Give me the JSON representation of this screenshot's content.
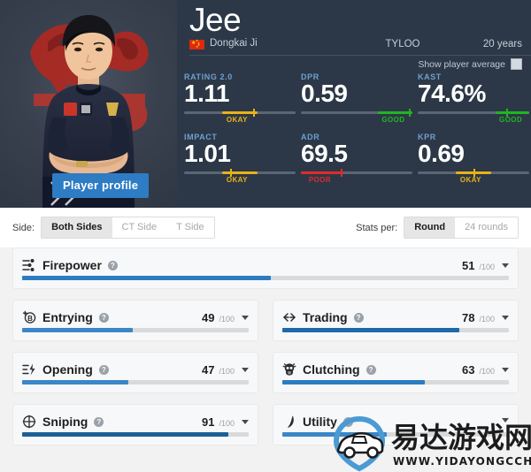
{
  "player": {
    "name": "Jee",
    "real_name": "Dongkai Ji",
    "country_icon": "china-flag-icon",
    "team": "TYLOO",
    "age": "20 years",
    "profile_button": "Player profile",
    "show_average_label": "Show player average"
  },
  "stats": [
    {
      "label": "RATING 2.0",
      "value": "1.11",
      "quality": "OKAY",
      "color": "#e8b317",
      "fill_start": 34,
      "fill_end": 66,
      "tick": 62
    },
    {
      "label": "DPR",
      "value": "0.59",
      "quality": "GOOD",
      "color": "#21b521",
      "fill_start": 69,
      "fill_end": 100,
      "tick": 97
    },
    {
      "label": "KAST",
      "value": "74.6%",
      "quality": "GOOD",
      "color": "#21b521",
      "fill_start": 70,
      "fill_end": 100,
      "tick": 79
    },
    {
      "label": "IMPACT",
      "value": "1.01",
      "quality": "OKAY",
      "color": "#e8b317",
      "fill_start": 34,
      "fill_end": 66,
      "tick": 41
    },
    {
      "label": "ADR",
      "value": "69.5",
      "quality": "POOR",
      "color": "#e02b2b",
      "fill_start": 0,
      "fill_end": 38,
      "tick": 36
    },
    {
      "label": "KPR",
      "value": "0.69",
      "quality": "OKAY",
      "color": "#e8b317",
      "fill_start": 34,
      "fill_end": 66,
      "tick": 50
    }
  ],
  "filters": {
    "side_label": "Side:",
    "side_options": [
      "Both Sides",
      "CT Side",
      "T Side"
    ],
    "side_selected": "Both Sides",
    "stats_per_label": "Stats per:",
    "stats_per_options": [
      "Round",
      "24 rounds"
    ],
    "stats_per_selected": "Round"
  },
  "skills": [
    {
      "name": "Firepower",
      "icon": "firepower-icon",
      "score": "51",
      "max": "/100",
      "pct": 51,
      "color": "#2b7cc0"
    },
    {
      "name": "Entrying",
      "icon": "entrying-icon",
      "score": "49",
      "max": "/100",
      "pct": 49,
      "color": "#3a86c8"
    },
    {
      "name": "Trading",
      "icon": "trading-icon",
      "score": "78",
      "max": "/100",
      "pct": 78,
      "color": "#1e6aa8"
    },
    {
      "name": "Opening",
      "icon": "opening-icon",
      "score": "47",
      "max": "/100",
      "pct": 47,
      "color": "#3a86c8"
    },
    {
      "name": "Clutching",
      "icon": "clutching-icon",
      "score": "63",
      "max": "/100",
      "pct": 63,
      "color": "#2b7cc0"
    },
    {
      "name": "Sniping",
      "icon": "sniping-icon",
      "score": "91",
      "max": "/100",
      "pct": 91,
      "color": "#1b5f97"
    },
    {
      "name": "Utility",
      "icon": "utility-icon",
      "score": "",
      "max": "",
      "pct": 46,
      "color": "#3a86c8"
    }
  ],
  "watermark": {
    "cn_text": "易达游戏网",
    "url_text": "WWW.YIDAYONGCCHE.COM",
    "icon": "car-pin-logo"
  }
}
